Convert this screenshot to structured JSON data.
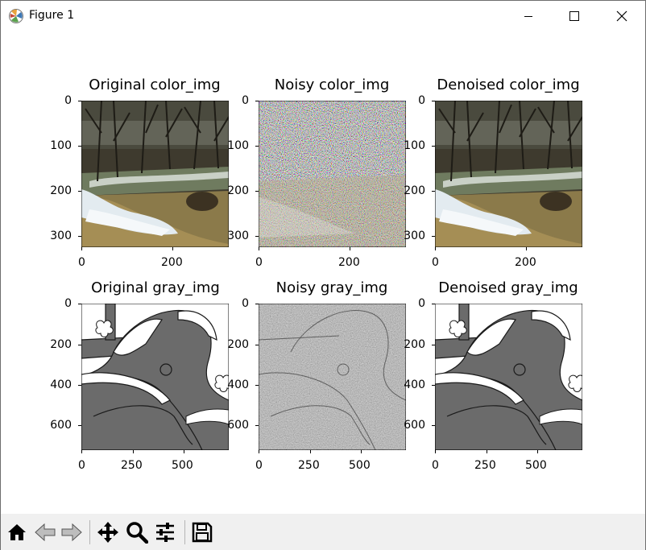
{
  "window": {
    "title": "Figure 1",
    "app_icon": "matplotlib-icon",
    "controls": [
      "minimize-icon",
      "maximize-icon",
      "close-icon"
    ]
  },
  "figure": {
    "panels": [
      {
        "id": "orig-color",
        "title": "Original color_img",
        "image": "color photo of a waterfall and stream beneath bare trees",
        "yticks": [
          "0",
          "100",
          "200",
          "300"
        ],
        "xticks": [
          "0",
          "200"
        ]
      },
      {
        "id": "noisy-color",
        "title": "Noisy color_img",
        "image": "same waterfall photo covered in colored noise",
        "yticks": [
          "0",
          "100",
          "200",
          "300"
        ],
        "xticks": [
          "0",
          "200"
        ]
      },
      {
        "id": "denoised-color",
        "title": "Denoised color_img",
        "image": "waterfall photo after denoising",
        "yticks": [
          "0",
          "100",
          "200",
          "300"
        ],
        "xticks": [
          "0",
          "200"
        ]
      },
      {
        "id": "orig-gray",
        "title": "Original gray_img",
        "image": "gray line-art drawing of a person resting head on arm",
        "yticks": [
          "0",
          "200",
          "400",
          "600"
        ],
        "xticks": [
          "0",
          "250",
          "500"
        ]
      },
      {
        "id": "noisy-gray",
        "title": "Noisy gray_img",
        "image": "same gray drawing covered in gray noise",
        "yticks": [
          "0",
          "200",
          "400",
          "600"
        ],
        "xticks": [
          "0",
          "250",
          "500"
        ]
      },
      {
        "id": "denoised-gray",
        "title": "Denoised gray_img",
        "image": "gray drawing after denoising",
        "yticks": [
          "0",
          "200",
          "400",
          "600"
        ],
        "xticks": [
          "0",
          "250",
          "500"
        ]
      }
    ]
  },
  "toolbar": {
    "buttons": [
      "home-icon",
      "back-icon",
      "forward-icon",
      "pan-icon",
      "zoom-icon",
      "configure-subplots-icon",
      "save-icon"
    ]
  },
  "colors": {
    "toolbar_bg": "#f0f0f0",
    "gray_fill": "#6b6b6b",
    "axes_edge": "#000000"
  }
}
